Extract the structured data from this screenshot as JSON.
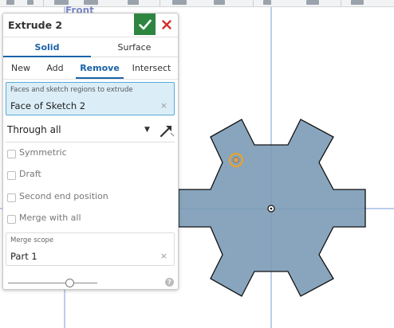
{
  "viewport": {
    "view_label": "Front",
    "sketch_fill": "#7b9bb6",
    "sketch_stroke": "#111111",
    "axis_color": "#7a9ed6",
    "highlight_color": "#f2a21b"
  },
  "toolbar": {
    "icons": [
      "cube-icon",
      "sketch-icon",
      "revolve-icon",
      "sweep-icon",
      "fillet-icon",
      "chamfer-icon",
      "shell-icon"
    ]
  },
  "panel": {
    "title": "Extrude 2",
    "confirm_icon": "check-icon",
    "cancel_icon": "close-icon",
    "type_tabs": [
      {
        "label": "Solid",
        "active": true
      },
      {
        "label": "Surface",
        "active": false
      }
    ],
    "operation_tabs": [
      {
        "label": "New",
        "active": false
      },
      {
        "label": "Add",
        "active": false
      },
      {
        "label": "Remove",
        "active": true
      },
      {
        "label": "Intersect",
        "active": false
      }
    ],
    "faces": {
      "caption": "Faces and sketch regions to extrude",
      "value": "Face of Sketch 2",
      "clear": "×"
    },
    "end_type": {
      "value": "Through all",
      "arrow": "▼",
      "flip_icon": "flip-direction-icon"
    },
    "options": [
      {
        "label": "Symmetric",
        "checked": false
      },
      {
        "label": "Draft",
        "checked": false
      },
      {
        "label": "Second end position",
        "checked": false
      },
      {
        "label": "Merge with all",
        "checked": false
      }
    ],
    "merge_scope": {
      "caption": "Merge scope",
      "value": "Part 1",
      "clear": "×"
    },
    "slider_value": 0.7,
    "help": "?"
  }
}
